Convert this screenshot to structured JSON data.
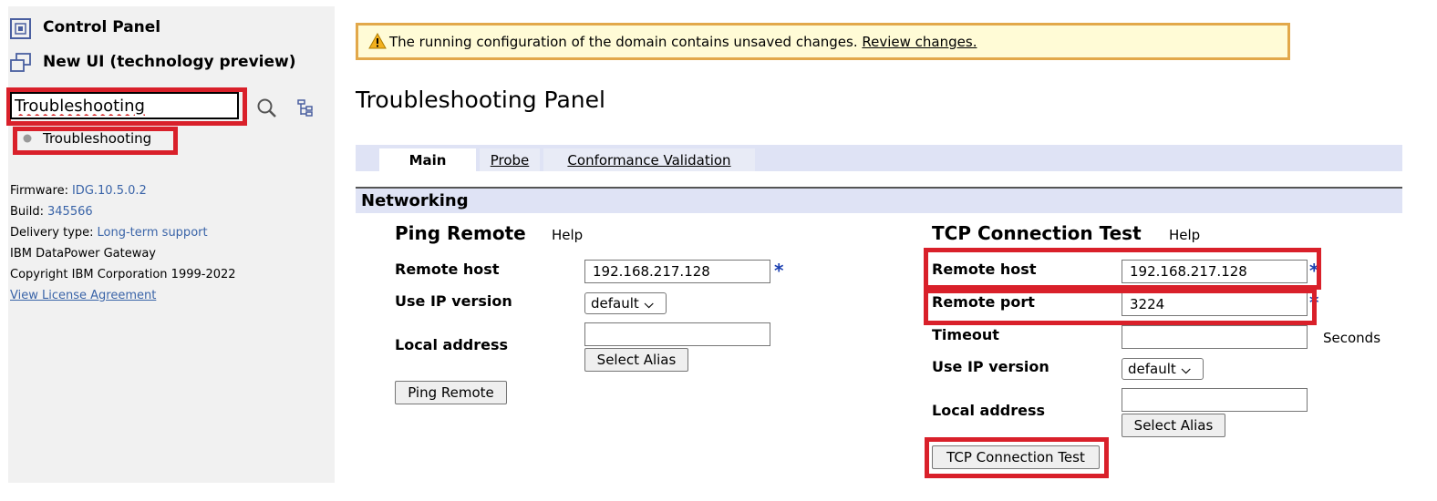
{
  "sidebar": {
    "control_panel": "Control Panel",
    "new_ui": "New UI (technology preview)",
    "search_value": "Troubleshooting",
    "result_item": "Troubleshooting",
    "firmware_label": "Firmware:",
    "firmware_value": "IDG.10.5.0.2",
    "build_label": "Build:",
    "build_value": "345566",
    "delivery_label": "Delivery type:",
    "delivery_value": "Long-term support",
    "product": "IBM DataPower Gateway",
    "copyright": "Copyright IBM Corporation 1999-2022",
    "license_link": "View License Agreement"
  },
  "warning": {
    "message": "The running configuration of the domain contains unsaved changes.",
    "link": "Review changes."
  },
  "page_title": "Troubleshooting Panel",
  "tabs": [
    {
      "label": "Main",
      "active": true
    },
    {
      "label": "Probe",
      "active": false
    },
    {
      "label": "Conformance Validation",
      "active": false
    }
  ],
  "section": "Networking",
  "ping": {
    "title": "Ping Remote",
    "help": "Help",
    "remote_host_label": "Remote host",
    "remote_host_value": "192.168.217.128",
    "ip_version_label": "Use IP version",
    "ip_version_value": "default",
    "local_address_label": "Local address",
    "local_address_value": "",
    "select_alias": "Select Alias",
    "button": "Ping Remote",
    "required_mark": "*"
  },
  "tcp": {
    "title": "TCP Connection Test",
    "help": "Help",
    "remote_host_label": "Remote host",
    "remote_host_value": "192.168.217.128",
    "remote_port_label": "Remote port",
    "remote_port_value": "3224",
    "timeout_label": "Timeout",
    "timeout_value": "",
    "timeout_unit": "Seconds",
    "ip_version_label": "Use IP version",
    "ip_version_value": "default",
    "local_address_label": "Local address",
    "local_address_value": "",
    "select_alias": "Select Alias",
    "button": "TCP Connection Test",
    "required_mark": "*"
  },
  "colors": {
    "highlight": "#d9202a",
    "band": "#dfe3f5",
    "warning_border": "#e2a84a",
    "warning_bg": "#fffbd6",
    "link": "#3a64a8",
    "required": "#1b3fb0"
  },
  "icons": [
    "control-panel-icon",
    "new-ui-icon",
    "search-icon",
    "tree-view-icon",
    "warning-icon",
    "chevron-down-icon"
  ]
}
